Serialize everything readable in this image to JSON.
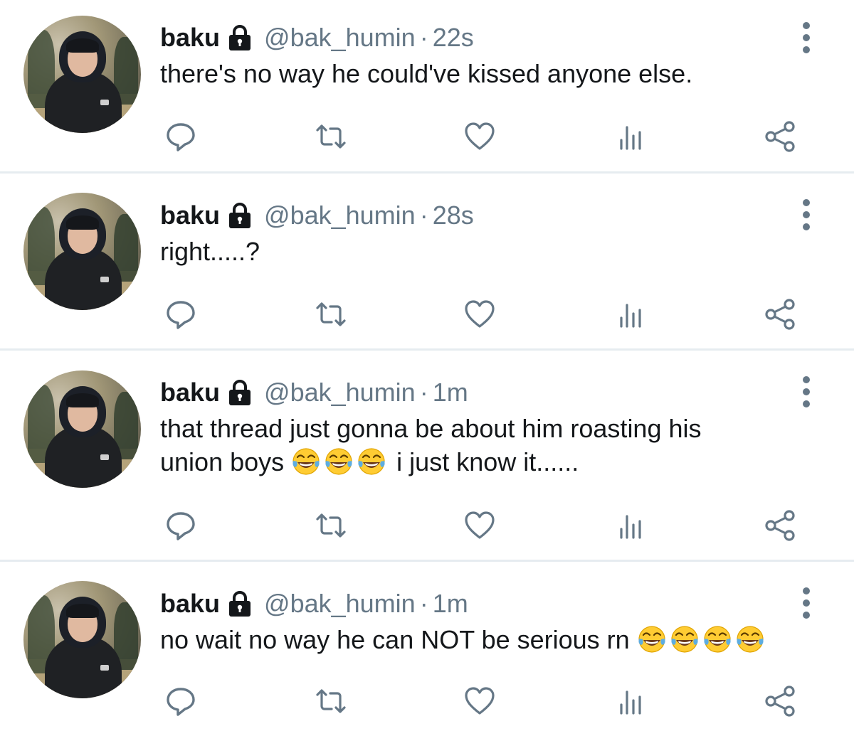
{
  "tweets": [
    {
      "name": "baku",
      "handle": "@bak_humin",
      "separator": "·",
      "time": "22s",
      "text_parts": [
        "there's no way he could've kissed anyone else."
      ],
      "line2": "",
      "emoji_count_line1": 0,
      "emoji_count_line2": 0,
      "trailing_text": ""
    },
    {
      "name": "baku",
      "handle": "@bak_humin",
      "separator": "·",
      "time": "28s",
      "text_parts": [
        "right.....?"
      ],
      "line2": "",
      "emoji_count_line1": 0,
      "emoji_count_line2": 0,
      "trailing_text": ""
    },
    {
      "name": "baku",
      "handle": "@bak_humin",
      "separator": "·",
      "time": "1m",
      "text_parts": [
        "that thread just gonna be about him roasting his"
      ],
      "line2": "union boys",
      "emoji_count_line1": 0,
      "emoji_count_line2": 3,
      "trailing_text": "i just know it......"
    },
    {
      "name": "baku",
      "handle": "@bak_humin",
      "separator": "·",
      "time": "1m",
      "text_parts": [
        "no wait no way he can NOT be serious rn"
      ],
      "line2": "",
      "emoji_count_line1": 4,
      "emoji_count_line2": 0,
      "trailing_text": ""
    }
  ],
  "icons": {
    "reply": "reply-icon",
    "retweet": "retweet-icon",
    "like": "heart-icon",
    "analytics": "analytics-icon",
    "share": "share-icon",
    "more": "more-options-icon",
    "lock": "lock-icon",
    "emoji": "face-with-tears-of-joy-emoji"
  },
  "colors": {
    "name": "#14171a",
    "meta": "#657786",
    "icon": "#657786",
    "divider": "#e6ecf0",
    "emoji_face": "#ffcc33",
    "emoji_tear": "#5dade2"
  }
}
